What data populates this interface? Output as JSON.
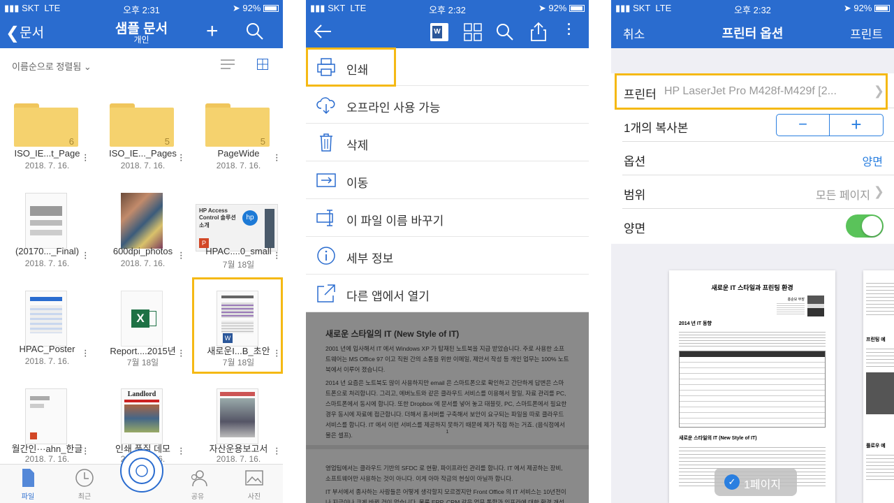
{
  "screen1": {
    "status": {
      "carrier": "SKT",
      "network": "LTE",
      "time": "오후 2:31",
      "battery": "92%"
    },
    "back_label": "문서",
    "title": "샘플 문서",
    "subtitle": "개인",
    "sort_label": "이름순으로 정렬됨",
    "files": [
      {
        "name": "ISO_IE...t_Page",
        "date": "2018. 7. 16.",
        "kind": "folder",
        "count": "6"
      },
      {
        "name": "ISO_IE..._Pages",
        "date": "2018. 7. 16.",
        "kind": "folder",
        "count": "5"
      },
      {
        "name": "PageWide",
        "date": "2018. 7. 16.",
        "kind": "folder",
        "count": "5"
      },
      {
        "name": "(20170..._Final)",
        "date": "2018. 7. 16.",
        "kind": "doc"
      },
      {
        "name": "600dpi_photos",
        "date": "2018. 7. 16.",
        "kind": "photo"
      },
      {
        "name": "HPAC....0_small",
        "date": "7월 18일",
        "kind": "ppt",
        "thumb_title": "HP Access Control 솔루션 소개"
      },
      {
        "name": "HPAC_Poster",
        "date": "2018. 7. 16.",
        "kind": "doc"
      },
      {
        "name": "Report....2015년",
        "date": "7월 18일",
        "kind": "excel"
      },
      {
        "name": "새로운I...B_초안",
        "date": "7월 18일",
        "kind": "word"
      },
      {
        "name": "월간인···ahn_한글",
        "date": "2018. 7. 16.",
        "kind": "doc"
      },
      {
        "name": "인쇄 품질 데모",
        "date": "2018. 7. 16.",
        "kind": "doc",
        "thumb_title": "Landlord"
      },
      {
        "name": "자산운용보고서",
        "date": "2018. 7. 16.",
        "kind": "doc"
      }
    ],
    "tabs": [
      "파일",
      "최근",
      "",
      "공유",
      "사진"
    ]
  },
  "screen2": {
    "status": {
      "carrier": "SKT",
      "network": "LTE",
      "time": "오후 2:32",
      "battery": "92%"
    },
    "menu": [
      "인쇄",
      "오프라인 사용 가능",
      "삭제",
      "이동",
      "이 파일 이름 바꾸기",
      "세부 정보",
      "다른 앱에서 열기"
    ],
    "doc_title": "새로운 스타일의 IT (New Style of IT)",
    "doc_p1": "2001 년에 입사해서 IT 에서 Windows XP 가 탑재된 노트북을 지급 받았습니다. 주로 사용한 소프트웨어는 MS Office 97 이고 직원 간의 소통을 위한 이메일, 제안서 작성 등 개인 업무는 100% 노트북에서 이루어 졌습니다.",
    "doc_p2": "2014 년 요즘은 노트북도 많이 사용하지만 email 은 스마트폰으로 확인하고 간단하게 답변은 스마트폰으로 처리합니다. 그리고, 에버노트와 같은 클라우드 서비스를 이용해서 할일, 자료 관리를 PC, 스마트폰에서 동시에 합니다. 또한 Dropbox 에 문서를 넣어 놓고 태블릿, PC, 스마트폰에서 필요한 경우 동시에 자료에 접근합니다. 더해서 홈서버를 구축해서 보안이 요구되는 파일을 따로 클라우드 서비스를 합니다. IT 에서 이런 서비스를 제공하지 못하기 때문에 제가 직접 하는 거죠. (음식점에서 물은 셀프).",
    "doc_page_num": "1",
    "doc_p3": "영업팀에서는 클라우드 기반의 SFDC 로 현황, 파이프라인 관리를 합니다. IT 에서 제공하는 장비, 소프트웨어만 사용하는 것이 아니다. 이게 아마 작금의 현실이 아닐까 합니다.",
    "doc_p4": "IT 부서에서 종사하는 사람들은 어떻게 생각할지 모르겠지만 Front Office 의 IT 서비스는 10년전이나 지금이나 크게 바뀐 것이 없습니다. 물론 ERP, CRM 같은 업무 통합과 인프라에 대한 환경 개선이 있"
  },
  "screen3": {
    "status": {
      "carrier": "SKT",
      "network": "LTE",
      "time": "오후 2:32",
      "battery": "92%"
    },
    "cancel": "취소",
    "title": "프린터 옵션",
    "print": "프린트",
    "printer_label": "프린터",
    "printer_value": "HP LaserJet Pro M428f-M429f [2...",
    "copies_label": "1개의 복사본",
    "options_label": "옵션",
    "options_value": "양면",
    "range_label": "범위",
    "range_value": "모든 페이지",
    "duplex_label": "양면",
    "duplex_on": true,
    "preview_title": "새로운 IT 스타일과 프린팅 환경",
    "preview_author": "홍순모 부장",
    "preview_section1": "2014 년 IT 동향",
    "preview_section2": "새로운 스타일의 IT (New Style of IT)",
    "preview_right1": "프린팅 예",
    "preview_right2": "플로우 예",
    "page_badge": "1페이지"
  },
  "colors": {
    "brand": "#2a6ccf",
    "highlight": "#f5b914",
    "toggle": "#5ac35a",
    "ios_blue": "#2a7fe0"
  }
}
